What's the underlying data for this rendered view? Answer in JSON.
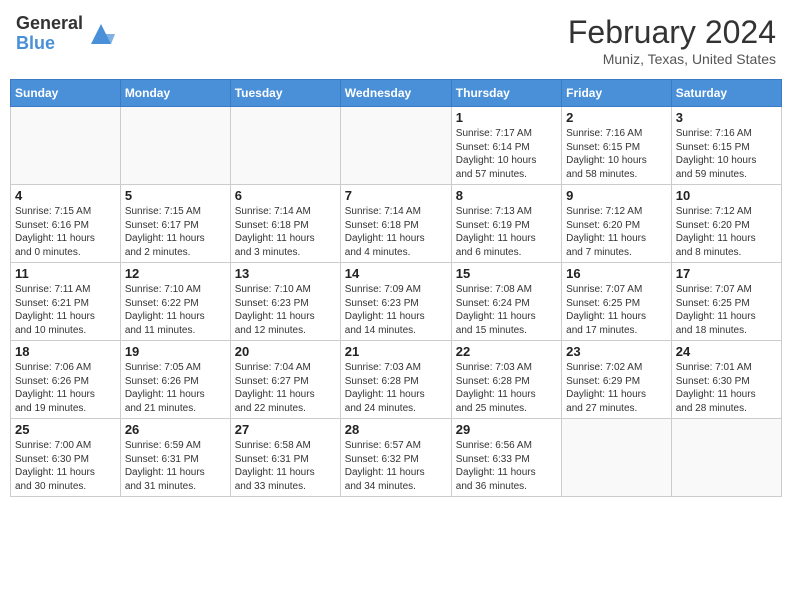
{
  "header": {
    "logo_general": "General",
    "logo_blue": "Blue",
    "month_year": "February 2024",
    "location": "Muniz, Texas, United States"
  },
  "days_of_week": [
    "Sunday",
    "Monday",
    "Tuesday",
    "Wednesday",
    "Thursday",
    "Friday",
    "Saturday"
  ],
  "weeks": [
    [
      {
        "day": "",
        "info": ""
      },
      {
        "day": "",
        "info": ""
      },
      {
        "day": "",
        "info": ""
      },
      {
        "day": "",
        "info": ""
      },
      {
        "day": "1",
        "info": "Sunrise: 7:17 AM\nSunset: 6:14 PM\nDaylight: 10 hours\nand 57 minutes."
      },
      {
        "day": "2",
        "info": "Sunrise: 7:16 AM\nSunset: 6:15 PM\nDaylight: 10 hours\nand 58 minutes."
      },
      {
        "day": "3",
        "info": "Sunrise: 7:16 AM\nSunset: 6:15 PM\nDaylight: 10 hours\nand 59 minutes."
      }
    ],
    [
      {
        "day": "4",
        "info": "Sunrise: 7:15 AM\nSunset: 6:16 PM\nDaylight: 11 hours\nand 0 minutes."
      },
      {
        "day": "5",
        "info": "Sunrise: 7:15 AM\nSunset: 6:17 PM\nDaylight: 11 hours\nand 2 minutes."
      },
      {
        "day": "6",
        "info": "Sunrise: 7:14 AM\nSunset: 6:18 PM\nDaylight: 11 hours\nand 3 minutes."
      },
      {
        "day": "7",
        "info": "Sunrise: 7:14 AM\nSunset: 6:18 PM\nDaylight: 11 hours\nand 4 minutes."
      },
      {
        "day": "8",
        "info": "Sunrise: 7:13 AM\nSunset: 6:19 PM\nDaylight: 11 hours\nand 6 minutes."
      },
      {
        "day": "9",
        "info": "Sunrise: 7:12 AM\nSunset: 6:20 PM\nDaylight: 11 hours\nand 7 minutes."
      },
      {
        "day": "10",
        "info": "Sunrise: 7:12 AM\nSunset: 6:20 PM\nDaylight: 11 hours\nand 8 minutes."
      }
    ],
    [
      {
        "day": "11",
        "info": "Sunrise: 7:11 AM\nSunset: 6:21 PM\nDaylight: 11 hours\nand 10 minutes."
      },
      {
        "day": "12",
        "info": "Sunrise: 7:10 AM\nSunset: 6:22 PM\nDaylight: 11 hours\nand 11 minutes."
      },
      {
        "day": "13",
        "info": "Sunrise: 7:10 AM\nSunset: 6:23 PM\nDaylight: 11 hours\nand 12 minutes."
      },
      {
        "day": "14",
        "info": "Sunrise: 7:09 AM\nSunset: 6:23 PM\nDaylight: 11 hours\nand 14 minutes."
      },
      {
        "day": "15",
        "info": "Sunrise: 7:08 AM\nSunset: 6:24 PM\nDaylight: 11 hours\nand 15 minutes."
      },
      {
        "day": "16",
        "info": "Sunrise: 7:07 AM\nSunset: 6:25 PM\nDaylight: 11 hours\nand 17 minutes."
      },
      {
        "day": "17",
        "info": "Sunrise: 7:07 AM\nSunset: 6:25 PM\nDaylight: 11 hours\nand 18 minutes."
      }
    ],
    [
      {
        "day": "18",
        "info": "Sunrise: 7:06 AM\nSunset: 6:26 PM\nDaylight: 11 hours\nand 19 minutes."
      },
      {
        "day": "19",
        "info": "Sunrise: 7:05 AM\nSunset: 6:26 PM\nDaylight: 11 hours\nand 21 minutes."
      },
      {
        "day": "20",
        "info": "Sunrise: 7:04 AM\nSunset: 6:27 PM\nDaylight: 11 hours\nand 22 minutes."
      },
      {
        "day": "21",
        "info": "Sunrise: 7:03 AM\nSunset: 6:28 PM\nDaylight: 11 hours\nand 24 minutes."
      },
      {
        "day": "22",
        "info": "Sunrise: 7:03 AM\nSunset: 6:28 PM\nDaylight: 11 hours\nand 25 minutes."
      },
      {
        "day": "23",
        "info": "Sunrise: 7:02 AM\nSunset: 6:29 PM\nDaylight: 11 hours\nand 27 minutes."
      },
      {
        "day": "24",
        "info": "Sunrise: 7:01 AM\nSunset: 6:30 PM\nDaylight: 11 hours\nand 28 minutes."
      }
    ],
    [
      {
        "day": "25",
        "info": "Sunrise: 7:00 AM\nSunset: 6:30 PM\nDaylight: 11 hours\nand 30 minutes."
      },
      {
        "day": "26",
        "info": "Sunrise: 6:59 AM\nSunset: 6:31 PM\nDaylight: 11 hours\nand 31 minutes."
      },
      {
        "day": "27",
        "info": "Sunrise: 6:58 AM\nSunset: 6:31 PM\nDaylight: 11 hours\nand 33 minutes."
      },
      {
        "day": "28",
        "info": "Sunrise: 6:57 AM\nSunset: 6:32 PM\nDaylight: 11 hours\nand 34 minutes."
      },
      {
        "day": "29",
        "info": "Sunrise: 6:56 AM\nSunset: 6:33 PM\nDaylight: 11 hours\nand 36 minutes."
      },
      {
        "day": "",
        "info": ""
      },
      {
        "day": "",
        "info": ""
      }
    ]
  ]
}
